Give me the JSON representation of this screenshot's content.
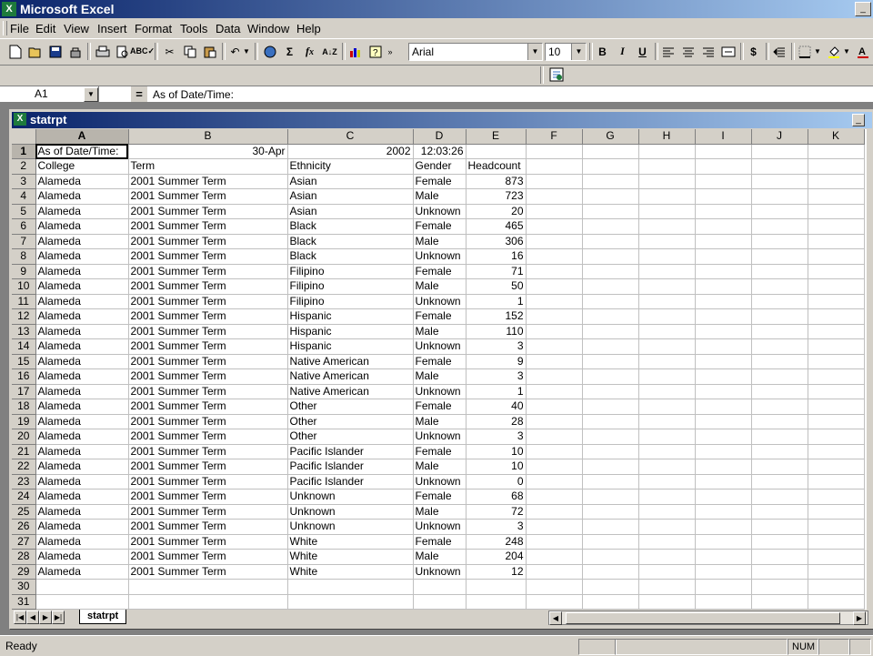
{
  "app": {
    "title": "Microsoft Excel",
    "icon": "excel-icon"
  },
  "menu": [
    "File",
    "Edit",
    "View",
    "Insert",
    "Format",
    "Tools",
    "Data",
    "Window",
    "Help"
  ],
  "toolbar": {
    "font": "Arial",
    "font_size": "10"
  },
  "formula_bar": {
    "cell_ref": "A1",
    "eq": "=",
    "content": "As of Date/Time:"
  },
  "workbook": {
    "title": "statrpt",
    "sheet_tab": "statrpt"
  },
  "columns": [
    "A",
    "B",
    "C",
    "D",
    "E",
    "F",
    "G",
    "H",
    "I",
    "J",
    "K"
  ],
  "header_row": {
    "a": "As of Date/Time:",
    "b": "30-Apr",
    "c": "2002",
    "d": "12:03:26"
  },
  "col_headers": {
    "college": "College",
    "term": "Term",
    "ethnicity": "Ethnicity",
    "gender": "Gender",
    "headcount": "Headcount"
  },
  "records": [
    {
      "college": "Alameda",
      "term": "2001 Summer Term",
      "ethnicity": "Asian",
      "gender": "Female",
      "headcount": "873"
    },
    {
      "college": "Alameda",
      "term": "2001 Summer Term",
      "ethnicity": "Asian",
      "gender": "Male",
      "headcount": "723"
    },
    {
      "college": "Alameda",
      "term": "2001 Summer Term",
      "ethnicity": "Asian",
      "gender": "Unknown",
      "headcount": "20"
    },
    {
      "college": "Alameda",
      "term": "2001 Summer Term",
      "ethnicity": "Black",
      "gender": "Female",
      "headcount": "465"
    },
    {
      "college": "Alameda",
      "term": "2001 Summer Term",
      "ethnicity": "Black",
      "gender": "Male",
      "headcount": "306"
    },
    {
      "college": "Alameda",
      "term": "2001 Summer Term",
      "ethnicity": "Black",
      "gender": "Unknown",
      "headcount": "16"
    },
    {
      "college": "Alameda",
      "term": "2001 Summer Term",
      "ethnicity": "Filipino",
      "gender": "Female",
      "headcount": "71"
    },
    {
      "college": "Alameda",
      "term": "2001 Summer Term",
      "ethnicity": "Filipino",
      "gender": "Male",
      "headcount": "50"
    },
    {
      "college": "Alameda",
      "term": "2001 Summer Term",
      "ethnicity": "Filipino",
      "gender": "Unknown",
      "headcount": "1"
    },
    {
      "college": "Alameda",
      "term": "2001 Summer Term",
      "ethnicity": "Hispanic",
      "gender": "Female",
      "headcount": "152"
    },
    {
      "college": "Alameda",
      "term": "2001 Summer Term",
      "ethnicity": "Hispanic",
      "gender": "Male",
      "headcount": "110"
    },
    {
      "college": "Alameda",
      "term": "2001 Summer Term",
      "ethnicity": "Hispanic",
      "gender": "Unknown",
      "headcount": "3"
    },
    {
      "college": "Alameda",
      "term": "2001 Summer Term",
      "ethnicity": "Native American",
      "gender": "Female",
      "headcount": "9"
    },
    {
      "college": "Alameda",
      "term": "2001 Summer Term",
      "ethnicity": "Native American",
      "gender": "Male",
      "headcount": "3"
    },
    {
      "college": "Alameda",
      "term": "2001 Summer Term",
      "ethnicity": "Native American",
      "gender": "Unknown",
      "headcount": "1"
    },
    {
      "college": "Alameda",
      "term": "2001 Summer Term",
      "ethnicity": "Other",
      "gender": "Female",
      "headcount": "40"
    },
    {
      "college": "Alameda",
      "term": "2001 Summer Term",
      "ethnicity": "Other",
      "gender": "Male",
      "headcount": "28"
    },
    {
      "college": "Alameda",
      "term": "2001 Summer Term",
      "ethnicity": "Other",
      "gender": "Unknown",
      "headcount": "3"
    },
    {
      "college": "Alameda",
      "term": "2001 Summer Term",
      "ethnicity": "Pacific Islander",
      "gender": "Female",
      "headcount": "10"
    },
    {
      "college": "Alameda",
      "term": "2001 Summer Term",
      "ethnicity": "Pacific Islander",
      "gender": "Male",
      "headcount": "10"
    },
    {
      "college": "Alameda",
      "term": "2001 Summer Term",
      "ethnicity": "Pacific Islander",
      "gender": "Unknown",
      "headcount": "0"
    },
    {
      "college": "Alameda",
      "term": "2001 Summer Term",
      "ethnicity": "Unknown",
      "gender": "Female",
      "headcount": "68"
    },
    {
      "college": "Alameda",
      "term": "2001 Summer Term",
      "ethnicity": "Unknown",
      "gender": "Male",
      "headcount": "72"
    },
    {
      "college": "Alameda",
      "term": "2001 Summer Term",
      "ethnicity": "Unknown",
      "gender": "Unknown",
      "headcount": "3"
    },
    {
      "college": "Alameda",
      "term": "2001 Summer Term",
      "ethnicity": "White",
      "gender": "Female",
      "headcount": "248"
    },
    {
      "college": "Alameda",
      "term": "2001 Summer Term",
      "ethnicity": "White",
      "gender": "Male",
      "headcount": "204"
    },
    {
      "college": "Alameda",
      "term": "2001 Summer Term",
      "ethnicity": "White",
      "gender": "Unknown",
      "headcount": "12"
    }
  ],
  "total_rows": 31,
  "status": {
    "ready": "Ready",
    "num": "NUM"
  },
  "colors": {
    "title_gradient_start": "#0a246a",
    "title_gradient_end": "#a6caf0",
    "chrome": "#d4d0c8"
  }
}
